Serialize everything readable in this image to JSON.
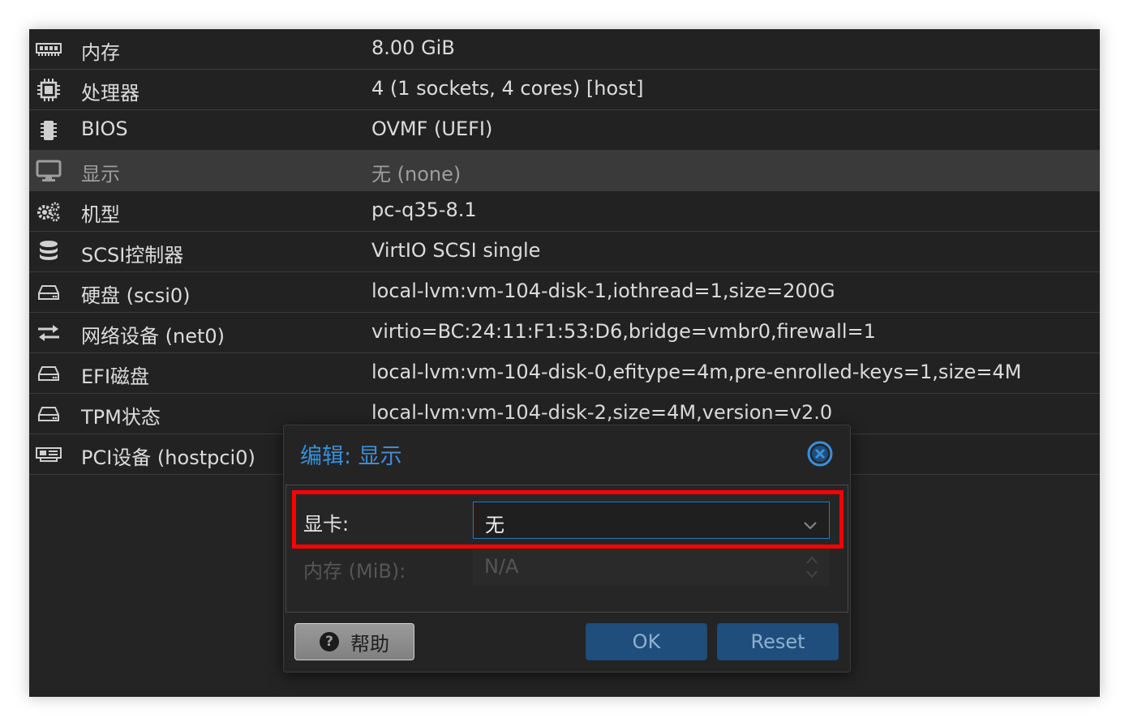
{
  "hardware": {
    "rows": [
      {
        "label": "内存",
        "value": "8.00 GiB",
        "icon": "memory-icon"
      },
      {
        "label": "处理器",
        "value": "4 (1 sockets, 4 cores) [host]",
        "icon": "cpu-icon"
      },
      {
        "label": "BIOS",
        "value": "OVMF (UEFI)",
        "icon": "bios-chip-icon"
      },
      {
        "label": "显示",
        "value": "无 (none)",
        "icon": "monitor-icon"
      },
      {
        "label": "机型",
        "value": "pc-q35-8.1",
        "icon": "gears-icon"
      },
      {
        "label": "SCSI控制器",
        "value": "VirtIO SCSI single",
        "icon": "database-icon"
      },
      {
        "label": "硬盘 (scsi0)",
        "value": "local-lvm:vm-104-disk-1,iothread=1,size=200G",
        "icon": "hdd-icon"
      },
      {
        "label": "网络设备 (net0)",
        "value": "virtio=BC:24:11:F1:53:D6,bridge=vmbr0,firewall=1",
        "icon": "exchange-icon"
      },
      {
        "label": "EFI磁盘",
        "value": "local-lvm:vm-104-disk-0,efitype=4m,pre-enrolled-keys=1,size=4M",
        "icon": "hdd-icon"
      },
      {
        "label": "TPM状态",
        "value": "local-lvm:vm-104-disk-2,size=4M,version=v2.0",
        "icon": "hdd-icon"
      },
      {
        "label": "PCI设备 (hostpci0)",
        "value": "",
        "icon": "pci-card-icon"
      }
    ],
    "selected_index": 3
  },
  "dialog": {
    "title": "编辑: 显示",
    "fields": {
      "graphics_card_label": "显卡:",
      "graphics_card_value": "无",
      "memory_label": "内存 (MiB):",
      "memory_placeholder": "N/A"
    },
    "buttons": {
      "help": "帮助",
      "ok": "OK",
      "reset": "Reset"
    }
  },
  "colors": {
    "accent": "#3a8fdb",
    "highlight": "#ff0000",
    "primary_button": "#1f4e7c"
  }
}
